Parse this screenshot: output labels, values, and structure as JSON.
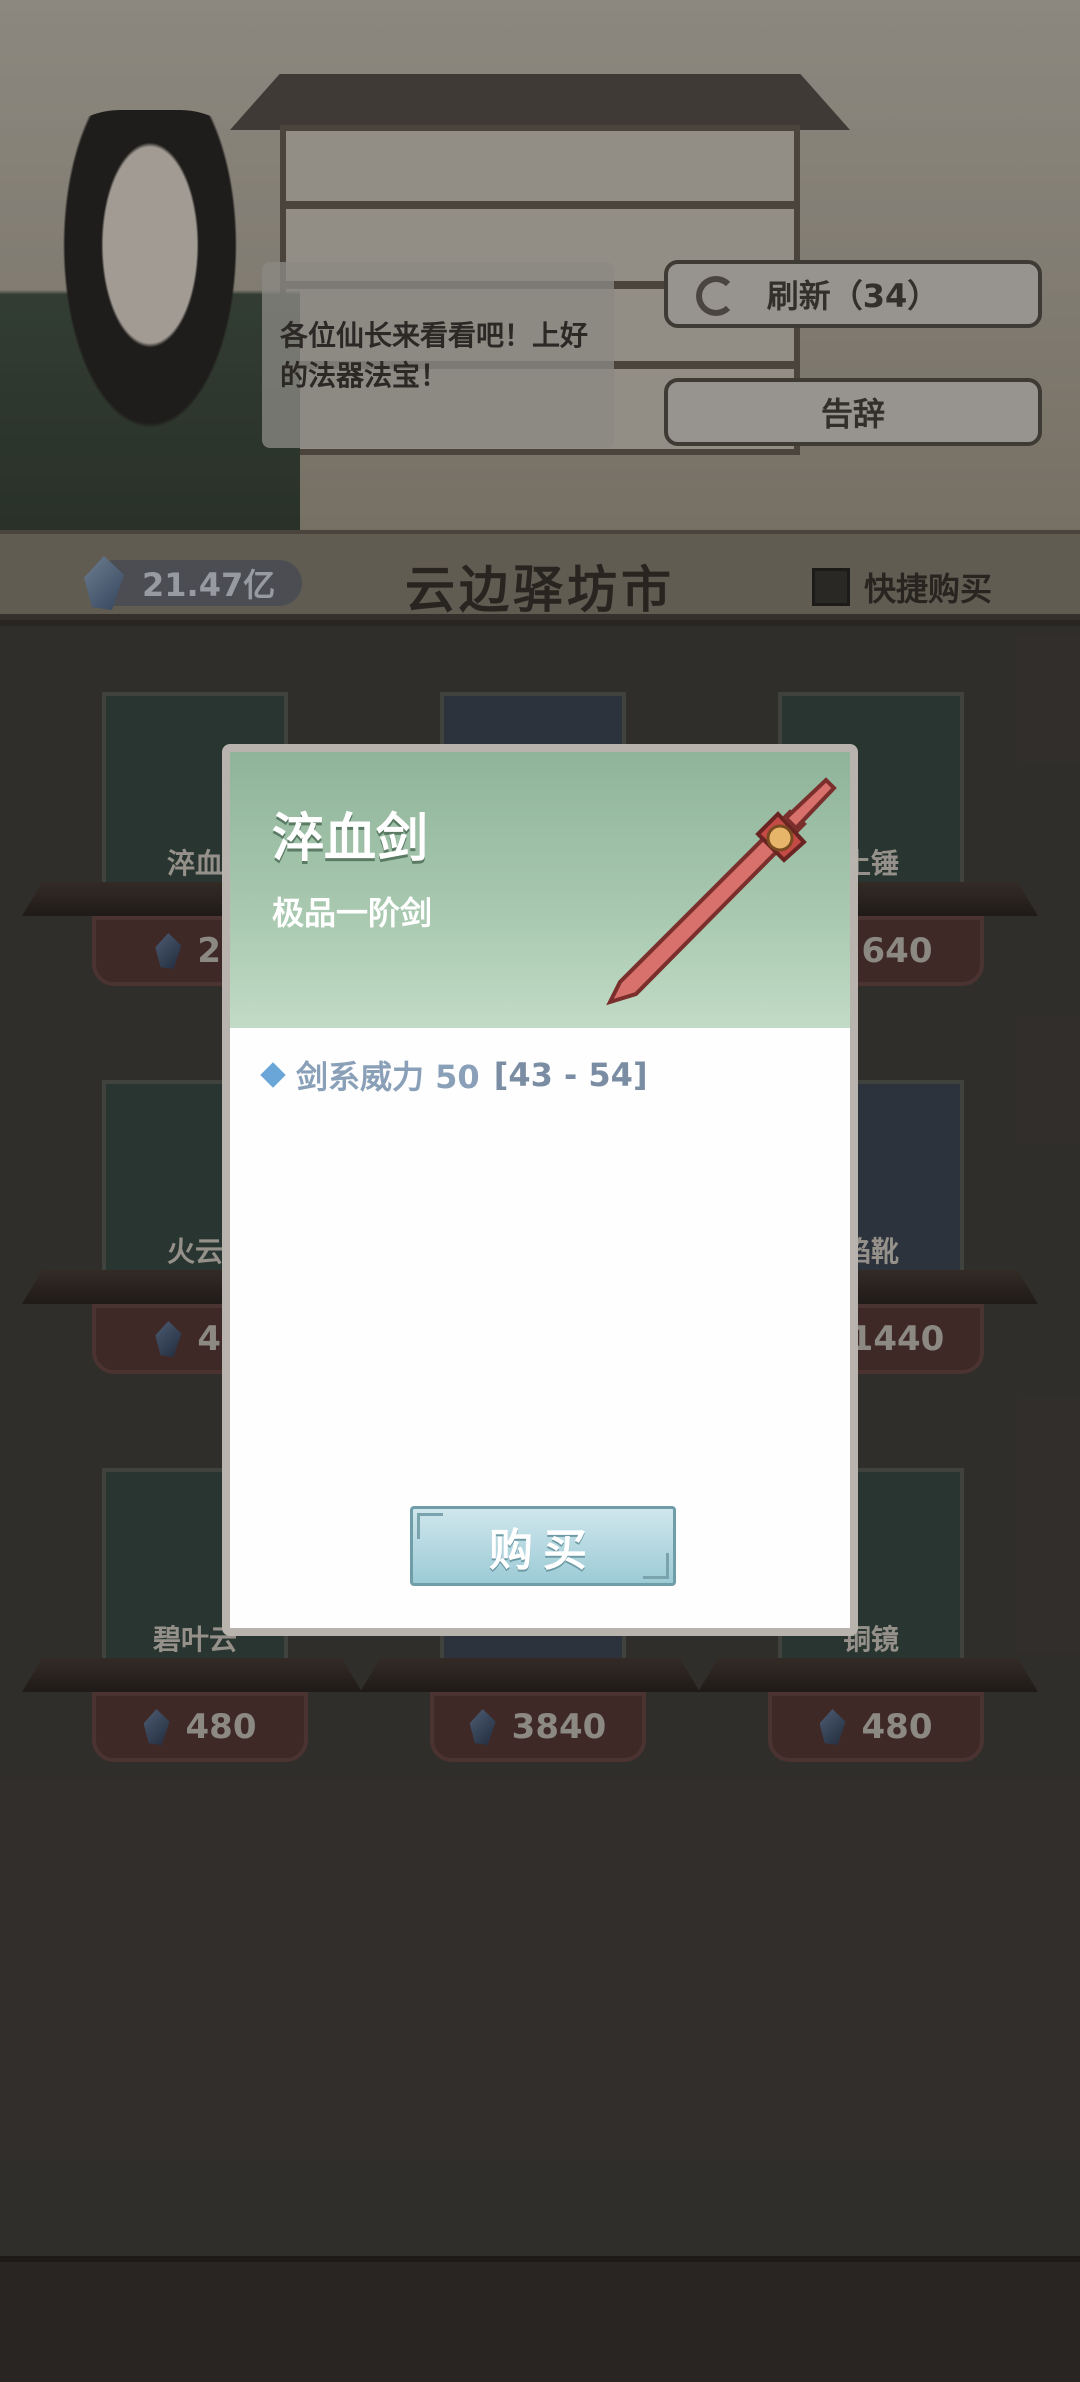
{
  "npc": {
    "speech": "各位仙长来看看吧！上好的法器法宝！"
  },
  "actions": {
    "refresh_label": "刷新（34）",
    "leave_label": "告辞"
  },
  "header": {
    "currency": "21.47亿",
    "title": "云边驿坊市",
    "quick_buy_label": "快捷购买",
    "quick_buy_checked": false
  },
  "items": [
    {
      "name": "淬血",
      "price": "22"
    },
    {
      "name": "",
      "price": ""
    },
    {
      "name": "土锤",
      "price": "640"
    },
    {
      "name": "火云",
      "price": "48"
    },
    {
      "name": "",
      "price": ""
    },
    {
      "name": "焰靴",
      "price": "1440"
    },
    {
      "name": "碧叶云",
      "price": "480"
    },
    {
      "name": "",
      "price": "3840"
    },
    {
      "name": "铜镜",
      "price": "480"
    }
  ],
  "modal": {
    "item_name": "淬血剑",
    "grade": "极品一阶剑",
    "stat_label": "剑系威力 50",
    "stat_range": "[43 - 54]",
    "buy_label": "购买"
  },
  "colors": {
    "modal_header": "#a9c9b0",
    "stat_text": "#8aa0b8",
    "buy_button": "#9ccbd6"
  }
}
